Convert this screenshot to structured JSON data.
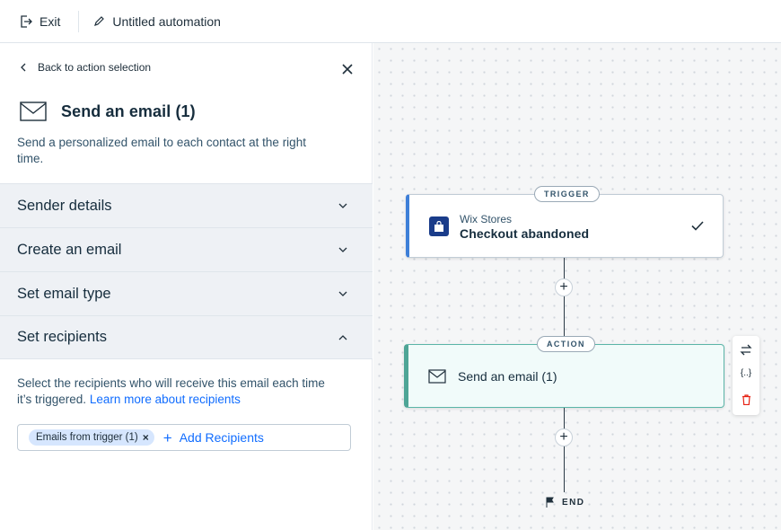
{
  "topbar": {
    "exit_label": "Exit",
    "automation_title": "Untitled automation"
  },
  "panel": {
    "back_label": "Back to action selection",
    "title": "Send an email (1)",
    "description": "Send a personalized email to each contact at the right time.",
    "sections": [
      {
        "label": "Sender details",
        "expanded": false
      },
      {
        "label": "Create an email",
        "expanded": false
      },
      {
        "label": "Set email type",
        "expanded": false
      },
      {
        "label": "Set recipients",
        "expanded": true
      }
    ],
    "recipients": {
      "text": "Select the recipients who will receive this email each time it’s triggered.",
      "link": "Learn more about recipients",
      "chip": "Emails from trigger (1)",
      "chip_remove": "×",
      "add_label": "Add Recipients",
      "add_icon": "+"
    }
  },
  "canvas": {
    "trigger": {
      "tag": "TRIGGER",
      "app": "Wix Stores",
      "event": "Checkout abandoned"
    },
    "action": {
      "tag": "ACTION",
      "name": "Send an email (1)"
    },
    "plus": "+",
    "tools": {
      "variables": "{..}"
    },
    "end_label": "END"
  },
  "colors": {
    "accent": "#116dff",
    "trigger_bar": "#3e7fd8",
    "action_bar": "#4ea596",
    "delete": "#e62214"
  }
}
